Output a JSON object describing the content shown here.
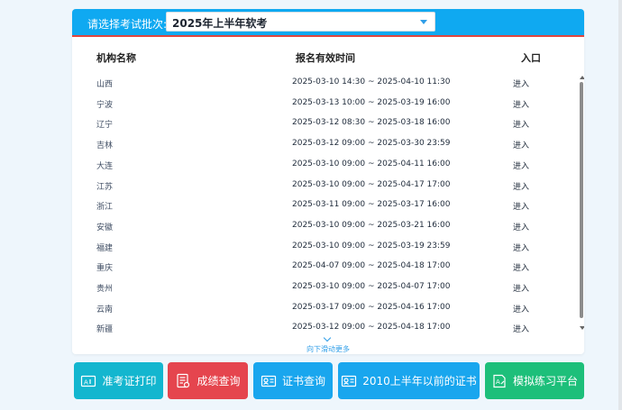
{
  "selector": {
    "label": "请选择考试批次:",
    "value": "2025年上半年软考"
  },
  "table": {
    "headers": [
      "机构名称",
      "报名有效时间",
      "入口"
    ],
    "rows": [
      {
        "org": "山西",
        "time": "2025-03-10 14:30 ~ 2025-04-10 11:30",
        "entry": "进入"
      },
      {
        "org": "宁波",
        "time": "2025-03-13 10:00 ~ 2025-03-19 16:00",
        "entry": "进入"
      },
      {
        "org": "辽宁",
        "time": "2025-03-12 08:30 ~ 2025-03-18 16:00",
        "entry": "进入"
      },
      {
        "org": "吉林",
        "time": "2025-03-12 09:00 ~ 2025-03-30 23:59",
        "entry": "进入"
      },
      {
        "org": "大连",
        "time": "2025-03-10 09:00 ~ 2025-04-11 16:00",
        "entry": "进入"
      },
      {
        "org": "江苏",
        "time": "2025-03-10 09:00 ~ 2025-04-17 17:00",
        "entry": "进入"
      },
      {
        "org": "浙江",
        "time": "2025-03-11 09:00 ~ 2025-03-17 16:00",
        "entry": "进入"
      },
      {
        "org": "安徽",
        "time": "2025-03-10 09:00 ~ 2025-03-21 16:00",
        "entry": "进入"
      },
      {
        "org": "福建",
        "time": "2025-03-10 09:00 ~ 2025-03-19 23:59",
        "entry": "进入"
      },
      {
        "org": "重庆",
        "time": "2025-04-07 09:00 ~ 2025-04-18 17:00",
        "entry": "进入"
      },
      {
        "org": "贵州",
        "time": "2025-03-10 09:00 ~ 2025-04-07 17:00",
        "entry": "进入"
      },
      {
        "org": "云南",
        "time": "2025-03-17 09:00 ~ 2025-04-16 17:00",
        "entry": "进入"
      },
      {
        "org": "新疆",
        "time": "2025-03-12 09:00 ~ 2025-04-18 17:00",
        "entry": "进入"
      }
    ],
    "scroll_more": "向下滑动更多"
  },
  "buttons": [
    {
      "label": "准考证打印",
      "icon": "admission-ticket-icon",
      "color": "#13b6cf"
    },
    {
      "label": "成绩查询",
      "icon": "score-report-icon",
      "color": "#e5454e"
    },
    {
      "label": "证书查询",
      "icon": "certificate-icon",
      "color": "#19a6ee"
    },
    {
      "label": "2010上半年以前的证书",
      "icon": "certificate-icon",
      "color": "#19a6ee"
    },
    {
      "label": "模拟练习平台",
      "icon": "practice-icon",
      "color": "#1dbf7a"
    }
  ],
  "colors": {
    "header": "#0fa9f1",
    "accent_line": "#e0463f",
    "link": "#2f9ee8"
  }
}
